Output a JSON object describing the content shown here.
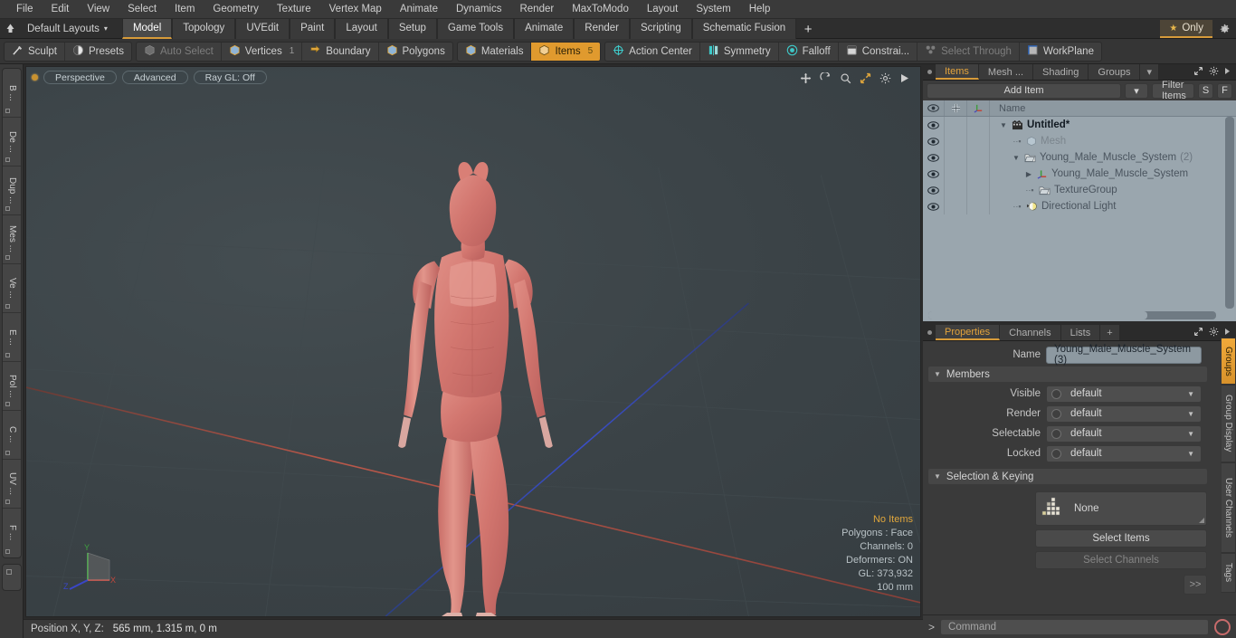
{
  "menu": {
    "items": [
      "File",
      "Edit",
      "View",
      "Select",
      "Item",
      "Geometry",
      "Texture",
      "Vertex Map",
      "Animate",
      "Dynamics",
      "Render",
      "MaxToModo",
      "Layout",
      "System",
      "Help"
    ]
  },
  "layout_bar": {
    "home_icon": "home-icon",
    "layout_name": "Default Layouts",
    "caret": "▾",
    "tabs": [
      "Model",
      "Topology",
      "UVEdit",
      "Paint",
      "Layout",
      "Setup",
      "Game Tools",
      "Animate",
      "Render",
      "Scripting",
      "Schematic Fusion"
    ],
    "active_tab": "Model",
    "add_tab": "+",
    "only_label": "Only",
    "only_star": "★",
    "gear_icon": "gear-icon",
    "accent_color": "#d79b3a"
  },
  "mode_bar": {
    "left_group": [
      {
        "label": "Sculpt",
        "icon": "sculpt-icon",
        "state": "normal"
      },
      {
        "label": "Presets",
        "icon": "presets-icon",
        "state": "normal"
      }
    ],
    "select_group": [
      {
        "label": "Auto Select",
        "icon": "cube-icon",
        "state": "dim",
        "num": ""
      },
      {
        "label": "Vertices",
        "icon": "vertices-icon",
        "state": "normal",
        "num": "1"
      },
      {
        "label": "Boundary",
        "icon": "boundary-icon",
        "state": "normal",
        "num": ""
      },
      {
        "label": "Polygons",
        "icon": "polygons-icon",
        "state": "normal",
        "num": ""
      }
    ],
    "item_group": [
      {
        "label": "Materials",
        "icon": "materials-icon",
        "state": "normal",
        "num": ""
      },
      {
        "label": "Items",
        "icon": "items-icon",
        "state": "selected",
        "num": "5"
      }
    ],
    "right_group": [
      {
        "label": "Action Center",
        "icon": "action-center-icon",
        "state": "normal"
      },
      {
        "label": "Symmetry",
        "icon": "symmetry-icon",
        "state": "normal"
      },
      {
        "label": "Falloff",
        "icon": "falloff-icon",
        "state": "normal"
      },
      {
        "label": "Constrai...",
        "icon": "constraint-icon",
        "state": "normal"
      },
      {
        "label": "Select Through",
        "icon": "select-through-icon",
        "state": "dim"
      },
      {
        "label": "WorkPlane",
        "icon": "workplane-icon",
        "state": "normal"
      }
    ]
  },
  "left_toolbox": {
    "tabs": [
      "B ...",
      "De ...",
      "Dup ...",
      "Mes ...",
      "Ve ...",
      "E ...",
      "Pol ...",
      "C ...",
      "UV ...",
      "F ..."
    ]
  },
  "viewport": {
    "dot": "viewport-indicator",
    "pills": [
      "Perspective",
      "Advanced",
      "Ray GL: Off"
    ],
    "tool_icons": [
      "move-icon",
      "rotate-icon",
      "zoom-icon",
      "fit-icon",
      "gear-icon",
      "play-icon"
    ],
    "stats": {
      "selection": "No Items",
      "polygons": "Polygons : Face",
      "channels": "Channels: 0",
      "deformers": "Deformers: ON",
      "gl": "GL: 373,932",
      "scale": "100 mm"
    },
    "gizmo": {
      "x": "X",
      "y": "Y",
      "z": "Z"
    },
    "model": "Young male muscle system anatomy figure"
  },
  "status_bar": {
    "label": "Position X, Y, Z:",
    "value": "565 mm, 1.315 m, 0 m"
  },
  "items_panel": {
    "tabs": [
      "Items",
      "Mesh ...",
      "Shading",
      "Groups"
    ],
    "active_tab": "Items",
    "tab_caret": "▾",
    "tools": [
      "expand-icon",
      "gear-icon",
      "arrow-right-icon"
    ],
    "add_item_label": "Add Item",
    "add_item_caret": "▾",
    "filter_placeholder": "Filter Items",
    "filter_buttons": [
      "S",
      "F"
    ],
    "columns": [
      "eye-column",
      "add-column",
      "axis-column",
      "Name"
    ],
    "rows": [
      {
        "name": "Untitled*",
        "icon": "scene-icon",
        "depth": 0,
        "twist": "▼",
        "bold": true,
        "dim": false,
        "count": ""
      },
      {
        "name": "Mesh",
        "icon": "mesh-icon",
        "depth": 1,
        "twist": "",
        "bold": false,
        "dim": true,
        "count": ""
      },
      {
        "name": "Young_Male_Muscle_System",
        "icon": "group-icon",
        "depth": 1,
        "twist": "▼",
        "bold": false,
        "dim": false,
        "count": "(2)"
      },
      {
        "name": "Young_Male_Muscle_System",
        "icon": "locator-icon",
        "depth": 2,
        "twist": "▶",
        "bold": false,
        "dim": false,
        "count": ""
      },
      {
        "name": "TextureGroup",
        "icon": "group-icon",
        "depth": 2,
        "twist": "",
        "bold": false,
        "dim": false,
        "count": ""
      },
      {
        "name": "Directional Light",
        "icon": "light-icon",
        "depth": 1,
        "twist": "",
        "bold": false,
        "dim": false,
        "count": ""
      }
    ]
  },
  "properties_panel": {
    "tabs": [
      "Properties",
      "Channels",
      "Lists"
    ],
    "active_tab": "Properties",
    "add_tab": "+",
    "tools": [
      "expand-icon",
      "gear-icon",
      "arrow-right-icon"
    ],
    "name_label": "Name",
    "name_value": "Young_Male_Muscle_System (3)",
    "members_section": "Members",
    "members_rows": [
      {
        "label": "Visible",
        "value": "default"
      },
      {
        "label": "Render",
        "value": "default"
      },
      {
        "label": "Selectable",
        "value": "default"
      },
      {
        "label": "Locked",
        "value": "default"
      }
    ],
    "selection_section": "Selection & Keying",
    "selection_value": "None",
    "select_items_label": "Select Items",
    "select_channels_label": "Select Channels",
    "expand_label": ">>",
    "side_tabs": [
      "Groups",
      "Group Display",
      "User Channels",
      "Tags"
    ],
    "active_side_tab": "Groups"
  },
  "command_bar": {
    "prompt": ">",
    "placeholder": "Command",
    "record_icon": "record-icon"
  }
}
